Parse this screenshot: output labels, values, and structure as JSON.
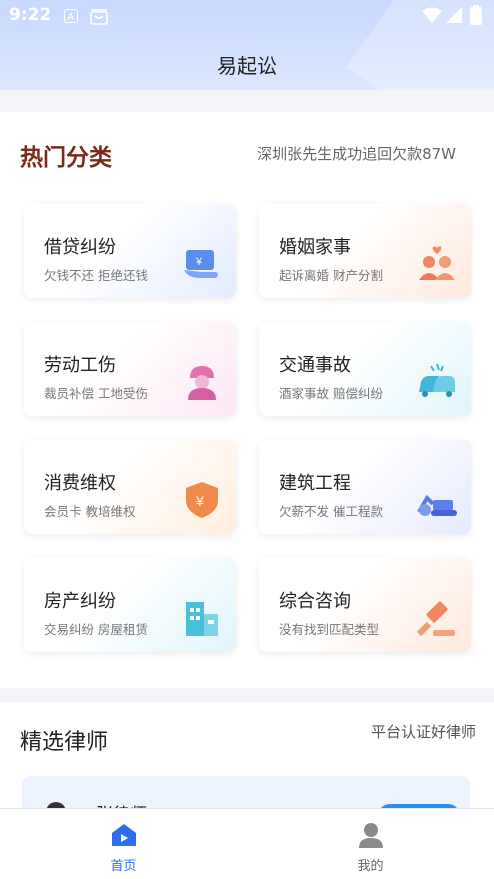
{
  "status": {
    "time": "9:22"
  },
  "header": {
    "title": "易起讼"
  },
  "hot": {
    "title": "热门分类",
    "ticker": "深圳张先生成功追回欠款87W",
    "categories": [
      {
        "name": "借贷纠纷",
        "desc": "欠钱不还 拒绝还钱",
        "icon": "wallet-icon"
      },
      {
        "name": "婚姻家事",
        "desc": "起诉离婚 财产分割",
        "icon": "couple-icon"
      },
      {
        "name": "劳动工伤",
        "desc": "裁员补偿 工地受伤",
        "icon": "worker-icon"
      },
      {
        "name": "交通事故",
        "desc": "酒家事故 赔偿纠纷",
        "icon": "car-crash-icon"
      },
      {
        "name": "消费维权",
        "desc": "会员卡 教培维权",
        "icon": "shield-yuan-icon"
      },
      {
        "name": "建筑工程",
        "desc": "欠薪不发 催工程款",
        "icon": "excavator-icon"
      },
      {
        "name": "房产纠纷",
        "desc": "交易纠纷 房屋租赁",
        "icon": "building-icon"
      },
      {
        "name": "综合咨询",
        "desc": "没有找到匹配类型",
        "icon": "gavel-icon"
      }
    ]
  },
  "lawyers": {
    "title": "精选律师",
    "sub": "平台认证好律师",
    "first_name": "张律师"
  },
  "tabs": [
    {
      "label": "首页",
      "color": "#2b6ef0"
    },
    {
      "label": "我的",
      "color": "#666666"
    }
  ]
}
